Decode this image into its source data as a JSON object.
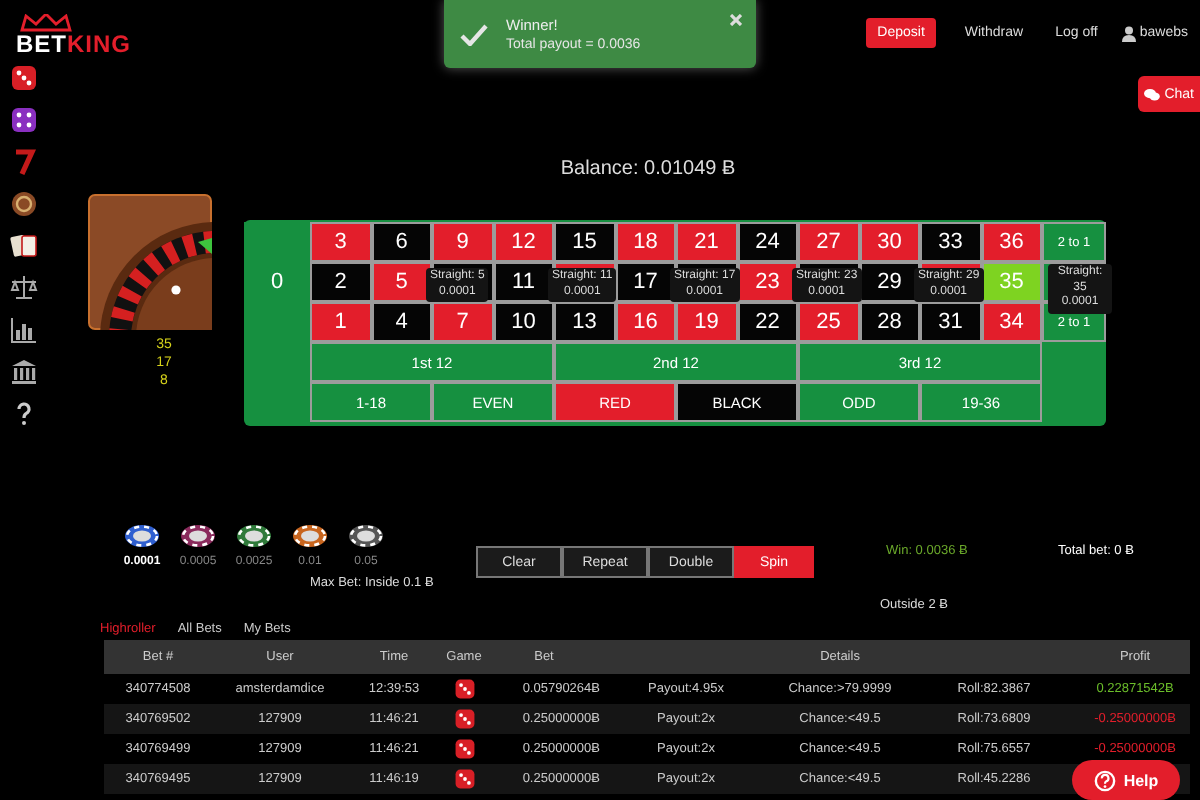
{
  "header": {
    "logo": {
      "word_1": "BET",
      "word_2": "KING"
    },
    "nav": [
      {
        "label": "Deposit",
        "kind": "primary"
      },
      {
        "label": "Withdraw",
        "kind": "link"
      },
      {
        "label": "Log off",
        "kind": "link"
      }
    ],
    "user": "bawebs"
  },
  "toast": {
    "title": "Winner!",
    "message": "Total payout = 0.0036"
  },
  "chat": {
    "label": "Chat"
  },
  "balance": "Balance: 0.01049 Ƀ",
  "last_numbers": [
    "35",
    "17",
    "8"
  ],
  "table": {
    "zero": "0",
    "rows": [
      [
        {
          "number": "3",
          "color": "#e31e2b"
        },
        {
          "number": "6",
          "color": "#050505"
        },
        {
          "number": "9",
          "color": "#e31e2b"
        },
        {
          "number": "12",
          "color": "#e31e2b"
        },
        {
          "number": "15",
          "color": "#050505"
        },
        {
          "number": "18",
          "color": "#e31e2b"
        },
        {
          "number": "21",
          "color": "#e31e2b"
        },
        {
          "number": "24",
          "color": "#050505"
        },
        {
          "number": "27",
          "color": "#e31e2b"
        },
        {
          "number": "30",
          "color": "#e31e2b"
        },
        {
          "number": "33",
          "color": "#050505"
        },
        {
          "number": "36",
          "color": "#e31e2b"
        }
      ],
      [
        {
          "number": "2",
          "color": "#050505"
        },
        {
          "number": "5",
          "color": "#e31e2b"
        },
        {
          "color": "#050505",
          "tooltip": {
            "label": "Straight: 5",
            "amount": "0.0001"
          }
        },
        {
          "number": "11",
          "color": "#050505"
        },
        {
          "color": "#e31e2b",
          "tooltip": {
            "label": "Straight: 11",
            "amount": "0.0001"
          }
        },
        {
          "number": "17",
          "color": "#050505"
        },
        {
          "color": "#050505",
          "tooltip": {
            "label": "Straight: 17",
            "amount": "0.0001"
          }
        },
        {
          "number": "23",
          "color": "#e31e2b"
        },
        {
          "color": "#050505",
          "tooltip": {
            "label": "Straight: 23",
            "amount": "0.0001"
          }
        },
        {
          "number": "29",
          "color": "#050505"
        },
        {
          "color": "#e31e2b",
          "tooltip": {
            "label": "Straight: 29",
            "amount": "0.0001"
          }
        },
        {
          "number": "35",
          "winner": true
        }
      ],
      [
        {
          "number": "1",
          "color": "#e31e2b"
        },
        {
          "number": "4",
          "color": "#050505"
        },
        {
          "number": "7",
          "color": "#e31e2b"
        },
        {
          "number": "10",
          "color": "#050505"
        },
        {
          "number": "13",
          "color": "#050505"
        },
        {
          "number": "16",
          "color": "#e31e2b"
        },
        {
          "number": "19",
          "color": "#e31e2b"
        },
        {
          "number": "22",
          "color": "#050505"
        },
        {
          "number": "25",
          "color": "#e31e2b"
        },
        {
          "number": "28",
          "color": "#050505"
        },
        {
          "number": "31",
          "color": "#050505"
        },
        {
          "number": "34",
          "color": "#e31e2b"
        }
      ]
    ],
    "column_bets": [
      {
        "label": "2 to 1"
      },
      {
        "tooltip": {
          "label": "Straight: 35",
          "amount": "0.0001"
        }
      },
      {
        "label": "2 to 1"
      }
    ],
    "dozens": [
      "1st 12",
      "2nd 12",
      "3rd 12"
    ],
    "outside": [
      {
        "label": "1-18"
      },
      {
        "label": "EVEN"
      },
      {
        "label": "RED",
        "color": "#e31e2b"
      },
      {
        "label": "BLACK",
        "color": "#050505"
      },
      {
        "label": "ODD"
      },
      {
        "label": "19-36"
      }
    ]
  },
  "chips": [
    {
      "value": "0.0001",
      "color": "#2f5fd0",
      "selected": true
    },
    {
      "value": "0.0005",
      "color": "#8a2a5c",
      "selected": false
    },
    {
      "value": "0.0025",
      "color": "#2f7a3a",
      "selected": false
    },
    {
      "value": "0.01",
      "color": "#c8651e",
      "selected": false
    },
    {
      "value": "0.05",
      "color": "#555555",
      "selected": false
    }
  ],
  "max_bet": "Max Bet: Inside 0.1 Ƀ",
  "actions": [
    {
      "label": "Clear",
      "kind": "plain"
    },
    {
      "label": "Repeat",
      "kind": "plain"
    },
    {
      "label": "Double",
      "kind": "plain"
    },
    {
      "label": "Spin",
      "kind": "primary"
    }
  ],
  "win": "Win: 0.0036 Ƀ",
  "total_bet": "Total bet: 0 Ƀ",
  "outside_max": "Outside 2 Ƀ",
  "bet_tabs": [
    {
      "label": "Highroller",
      "selected": true
    },
    {
      "label": "All Bets",
      "selected": false
    },
    {
      "label": "My Bets",
      "selected": false
    }
  ],
  "bets": {
    "columns": [
      "Bet #",
      "User",
      "Time",
      "Game",
      "Bet",
      "Details",
      "Profit"
    ],
    "rows": [
      {
        "bet_no": "340774508",
        "user": "amsterdamdice",
        "time": "12:39:53",
        "bet": "0.05790264Ƀ",
        "payout": "Payout:4.95x",
        "chance": "Chance:>79.9999",
        "roll": "Roll:82.3867",
        "profit": "0.22871542Ƀ",
        "kind": "win"
      },
      {
        "bet_no": "340769502",
        "user": "127909",
        "time": "11:46:21",
        "bet": "0.25000000Ƀ",
        "payout": "Payout:2x",
        "chance": "Chance:<49.5",
        "roll": "Roll:73.6809",
        "profit": "-0.25000000Ƀ",
        "kind": "loss"
      },
      {
        "bet_no": "340769499",
        "user": "127909",
        "time": "11:46:21",
        "bet": "0.25000000Ƀ",
        "payout": "Payout:2x",
        "chance": "Chance:<49.5",
        "roll": "Roll:75.6557",
        "profit": "-0.25000000Ƀ",
        "kind": "loss"
      },
      {
        "bet_no": "340769495",
        "user": "127909",
        "time": "11:46:19",
        "bet": "0.25000000Ƀ",
        "payout": "Payout:2x",
        "chance": "Chance:<49.5",
        "roll": "Roll:45.2286"
      }
    ]
  },
  "help": {
    "label": "Help"
  }
}
